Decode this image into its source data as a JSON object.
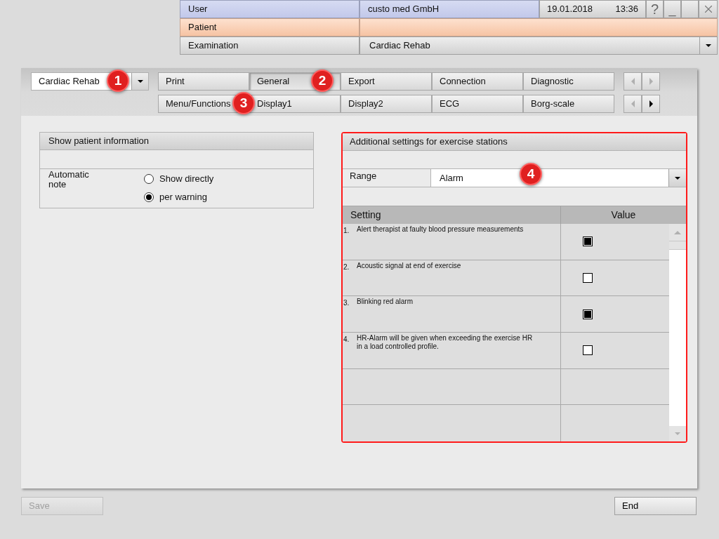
{
  "header": {
    "user": {
      "label": "User",
      "value": "custo med GmbH"
    },
    "date": "19.01.2018",
    "time": "13:36",
    "help": "?",
    "minimize": "_",
    "patient": {
      "label": "Patient"
    },
    "examination": {
      "label": "Examination",
      "value": "Cardiac Rehab"
    }
  },
  "profile_select": {
    "value": "Cardiac Rehab"
  },
  "tab_rows": [
    {
      "tabs": [
        {
          "label": "Print",
          "selected": false
        },
        {
          "label": "General",
          "selected": true
        },
        {
          "label": "Export",
          "selected": false
        },
        {
          "label": "Connection",
          "selected": false
        },
        {
          "label": "Diagnostic",
          "selected": false
        }
      ],
      "prev_disabled": true,
      "next_disabled": true
    },
    {
      "tabs": [
        {
          "label": "Menu/Functions",
          "selected": false
        },
        {
          "label": "Display1",
          "selected": false
        },
        {
          "label": "Display2",
          "selected": false
        },
        {
          "label": "ECG",
          "selected": false
        },
        {
          "label": "Borg-scale",
          "selected": false
        }
      ],
      "prev_disabled": true,
      "next_disabled": false
    }
  ],
  "patient_info": {
    "title": "Show patient information",
    "label": "Automatic note",
    "options": [
      {
        "label": "Show directly",
        "selected": false
      },
      {
        "label": "per warning",
        "selected": true
      }
    ]
  },
  "exercise_settings": {
    "title": "Additional settings for exercise stations",
    "range_label": "Range",
    "range_value": "Alarm",
    "columns": [
      "Setting",
      "Value"
    ],
    "rows": [
      {
        "number": "1.",
        "text": "Alert therapist at faulty blood pressure measurements",
        "checked": true
      },
      {
        "number": "2.",
        "text": "Acoustic signal at end of exercise",
        "checked": false
      },
      {
        "number": "3.",
        "text": "Blinking red alarm",
        "checked": true
      },
      {
        "number": "4.",
        "text": "HR-Alarm will be given  when exceeding the exercise HR in a load controlled profile.",
        "checked": false
      }
    ]
  },
  "callouts": [
    "1",
    "2",
    "3",
    "4"
  ],
  "buttons": {
    "save": {
      "label": "Save",
      "disabled": true
    },
    "end": {
      "label": "End",
      "disabled": false
    }
  }
}
